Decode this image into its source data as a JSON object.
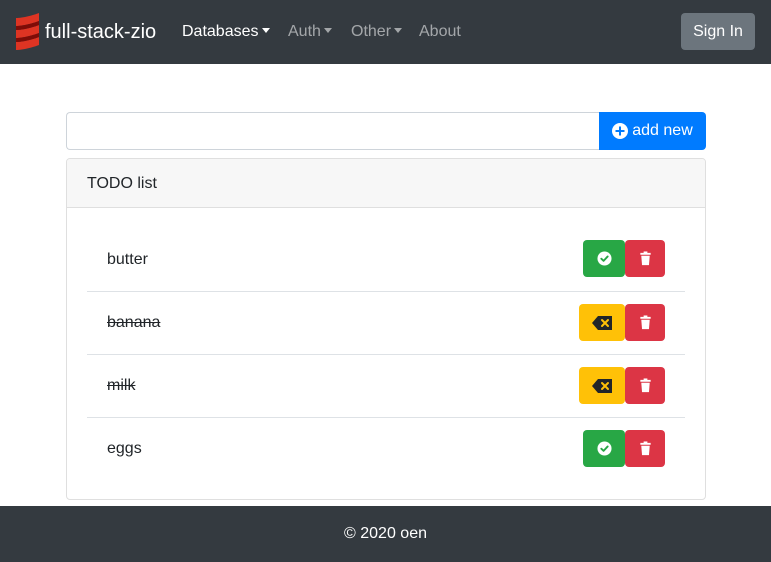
{
  "navbar": {
    "brand": "full-stack-zio",
    "items": [
      {
        "label": "Databases",
        "dropdown": true,
        "active": true
      },
      {
        "label": "Auth",
        "dropdown": true,
        "active": false
      },
      {
        "label": "Other",
        "dropdown": true,
        "active": false
      },
      {
        "label": "About",
        "dropdown": false,
        "active": false
      }
    ],
    "sign_in": "Sign In"
  },
  "add_form": {
    "input_value": "",
    "placeholder": "",
    "add_label": "add new",
    "add_icon": "plus-circle-icon"
  },
  "todo_card": {
    "header": "TODO list",
    "items": [
      {
        "text": "butter",
        "done": false,
        "toggle_icon": "check-circle-icon",
        "delete_icon": "trash-icon"
      },
      {
        "text": "banana",
        "done": true,
        "toggle_icon": "backspace-icon",
        "delete_icon": "trash-icon"
      },
      {
        "text": "milk",
        "done": true,
        "toggle_icon": "backspace-icon",
        "delete_icon": "trash-icon"
      },
      {
        "text": "eggs",
        "done": false,
        "toggle_icon": "check-circle-icon",
        "delete_icon": "trash-icon"
      }
    ]
  },
  "footer": {
    "text": "© 2020 oen"
  },
  "colors": {
    "navbar_bg": "#343a40",
    "primary": "#007bff",
    "success": "#28a745",
    "warning": "#ffc107",
    "danger": "#dc3545",
    "secondary": "#6c757d"
  }
}
